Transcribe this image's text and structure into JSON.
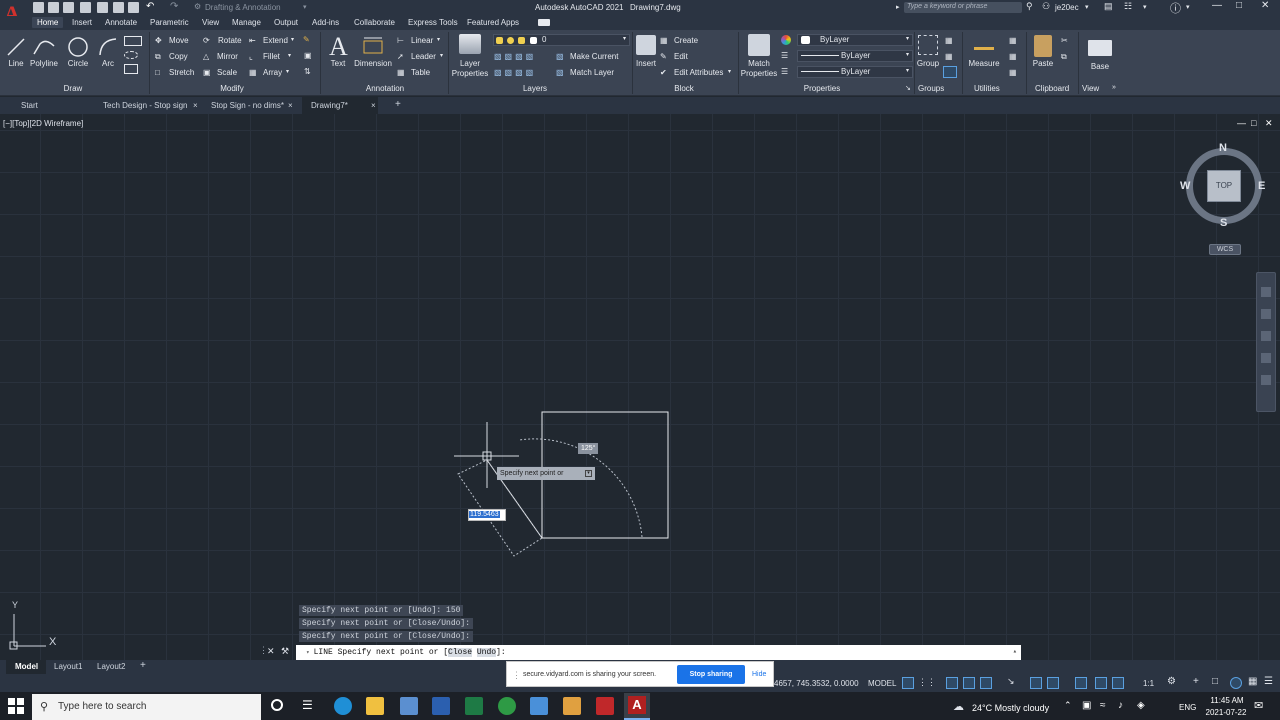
{
  "title_bar": {
    "app_logo": "A",
    "workspace": "Drafting & Annotation",
    "app_title": "Autodesk AutoCAD 2021",
    "drawing_name": "Drawing7.dwg",
    "search_placeholder": "Type a keyword or phrase",
    "user": "je20ec"
  },
  "menu_tabs": [
    "Home",
    "Insert",
    "Annotate",
    "Parametric",
    "View",
    "Manage",
    "Output",
    "Add-ins",
    "Collaborate",
    "Express Tools",
    "Featured Apps"
  ],
  "ribbon": {
    "draw": {
      "line": "Line",
      "polyline": "Polyline",
      "circle": "Circle",
      "arc": "Arc",
      "panel": "Draw"
    },
    "modify": {
      "move": "Move",
      "rotate": "Rotate",
      "extend": "Extend",
      "copy": "Copy",
      "mirror": "Mirror",
      "fillet": "Fillet",
      "stretch": "Stretch",
      "scale": "Scale",
      "array": "Array",
      "panel": "Modify"
    },
    "annotation": {
      "text": "Text",
      "dimension": "Dimension",
      "linear": "Linear",
      "leader": "Leader",
      "table": "Table",
      "panel": "Annotation"
    },
    "layers": {
      "layer_properties_1": "Layer",
      "layer_properties_2": "Properties",
      "current_layer": "0",
      "make_current": "Make Current",
      "match_layer": "Match Layer",
      "panel": "Layers"
    },
    "block": {
      "insert": "Insert",
      "create": "Create",
      "edit": "Edit",
      "edit_attributes": "Edit Attributes",
      "panel": "Block"
    },
    "properties": {
      "match_1": "Match",
      "match_2": "Properties",
      "color": "ByLayer",
      "linetype": "ByLayer",
      "lineweight": "ByLayer",
      "panel": "Properties"
    },
    "groups": {
      "group": "Group",
      "panel": "Groups"
    },
    "utilities": {
      "measure": "Measure",
      "panel": "Utilities"
    },
    "clipboard": {
      "paste": "Paste",
      "panel": "Clipboard"
    },
    "view": {
      "base": "Base",
      "panel": "View"
    }
  },
  "doc_tabs": [
    "Start",
    "Tech Design - Stop sign",
    "Stop Sign - no dims*",
    "Drawing7*"
  ],
  "viewport": {
    "label": "[−][Top][2D Wireframe]",
    "viewcube": {
      "n": "N",
      "s": "S",
      "e": "E",
      "w": "W",
      "face": "TOP",
      "wcs": "WCS"
    },
    "ucs": {
      "x": "X",
      "y": "Y"
    }
  },
  "drawing": {
    "angle_tooltip": "125°",
    "prompt_tooltip": "Specify next point or",
    "length_input": "119.5463"
  },
  "command_history": [
    "Specify next point or [Undo]: 150",
    "Specify next point or [Close/Undo]:",
    "Specify next point or [Close/Undo]:"
  ],
  "command_line": {
    "prefix": "LINE Specify next point or [",
    "close": "Close",
    "undo": "Undo",
    "suffix": "]:"
  },
  "screen_share": {
    "message": "secure.vidyard.com is sharing your screen.",
    "stop": "Stop sharing",
    "hide": "Hide"
  },
  "layout_tabs": [
    "Model",
    "Layout1",
    "Layout2"
  ],
  "status_bar": {
    "coords": "4657, 745.3532, 0.0000",
    "space": "MODEL",
    "scale": "1:1"
  },
  "taskbar": {
    "search_placeholder": "Type here to search",
    "weather": "24°C  Mostly cloudy",
    "language": "ENG",
    "time": "11:45 AM",
    "date": "2021-07-22"
  }
}
